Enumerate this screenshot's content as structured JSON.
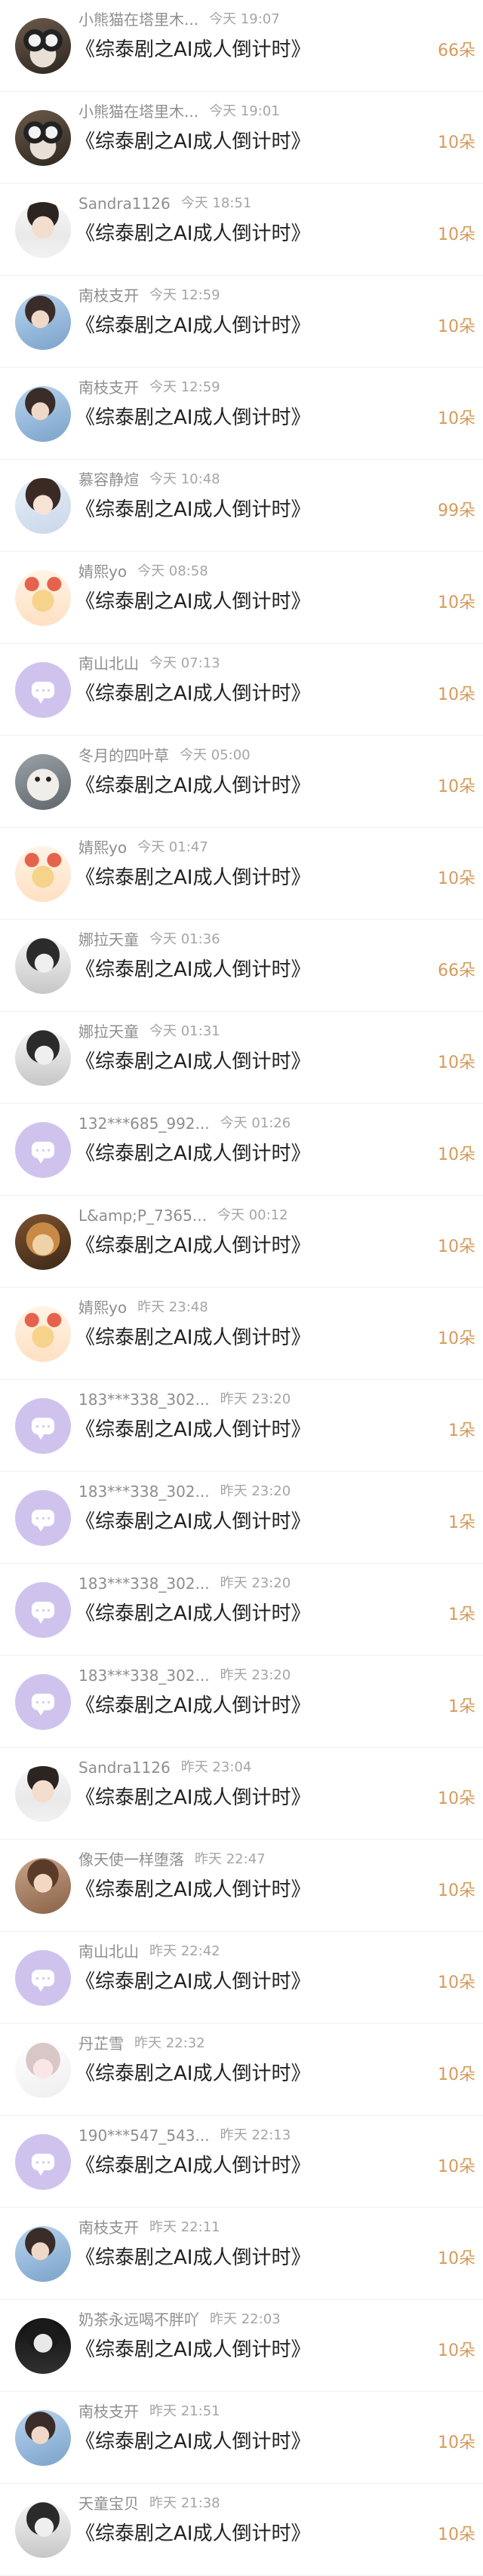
{
  "colors": {
    "accent": "#d69a5b",
    "name": "#8e8e8e",
    "time": "#a5a5a5",
    "title": "#222222",
    "placeholder_avatar": "#cfc3ee"
  },
  "rows": [
    {
      "name": "小熊猫在塔里木...",
      "time": "今天 19:07",
      "title": "《综泰剧之AI成人倒计时》",
      "amount": "66朵",
      "avatar": "photo-panda"
    },
    {
      "name": "小熊猫在塔里木...",
      "time": "今天 19:01",
      "title": "《综泰剧之AI成人倒计时》",
      "amount": "10朵",
      "avatar": "photo-panda"
    },
    {
      "name": "Sandra1126",
      "time": "今天 18:51",
      "title": "《综泰剧之AI成人倒计时》",
      "amount": "10朵",
      "avatar": "photo-boy"
    },
    {
      "name": "南枝支开",
      "time": "今天 12:59",
      "title": "《综泰剧之AI成人倒计时》",
      "amount": "10朵",
      "avatar": "photo-sky"
    },
    {
      "name": "南枝支开",
      "time": "今天 12:59",
      "title": "《综泰剧之AI成人倒计时》",
      "amount": "10朵",
      "avatar": "photo-sky"
    },
    {
      "name": "慕容静煊",
      "time": "今天 10:48",
      "title": "《综泰剧之AI成人倒计时》",
      "amount": "99朵",
      "avatar": "photo-girl"
    },
    {
      "name": "婧熙yo",
      "time": "今天 08:58",
      "title": "《综泰剧之AI成人倒计时》",
      "amount": "10朵",
      "avatar": "photo-cute"
    },
    {
      "name": "南山北山",
      "time": "今天 07:13",
      "title": "《综泰剧之AI成人倒计时》",
      "amount": "10朵",
      "avatar": "placeholder"
    },
    {
      "name": "冬月的四叶草",
      "time": "今天 05:00",
      "title": "《综泰剧之AI成人倒计时》",
      "amount": "10朵",
      "avatar": "photo-cat"
    },
    {
      "name": "婧熙yo",
      "time": "今天 01:47",
      "title": "《综泰剧之AI成人倒计时》",
      "amount": "10朵",
      "avatar": "photo-cute"
    },
    {
      "name": "娜拉天童",
      "time": "今天 01:36",
      "title": "《综泰剧之AI成人倒计时》",
      "amount": "66朵",
      "avatar": "photo-bw"
    },
    {
      "name": "娜拉天童",
      "time": "今天 01:31",
      "title": "《综泰剧之AI成人倒计时》",
      "amount": "10朵",
      "avatar": "photo-bw"
    },
    {
      "name": "132***685_992...",
      "time": "今天 01:26",
      "title": "《综泰剧之AI成人倒计时》",
      "amount": "10朵",
      "avatar": "placeholder"
    },
    {
      "name": "L&amp;P_7365...",
      "time": "今天 00:12",
      "title": "《综泰剧之AI成人倒计时》",
      "amount": "10朵",
      "avatar": "photo-dog"
    },
    {
      "name": "婧熙yo",
      "time": "昨天 23:48",
      "title": "《综泰剧之AI成人倒计时》",
      "amount": "10朵",
      "avatar": "photo-cute"
    },
    {
      "name": "183***338_302...",
      "time": "昨天 23:20",
      "title": "《综泰剧之AI成人倒计时》",
      "amount": "1朵",
      "avatar": "placeholder"
    },
    {
      "name": "183***338_302...",
      "time": "昨天 23:20",
      "title": "《综泰剧之AI成人倒计时》",
      "amount": "1朵",
      "avatar": "placeholder"
    },
    {
      "name": "183***338_302...",
      "time": "昨天 23:20",
      "title": "《综泰剧之AI成人倒计时》",
      "amount": "1朵",
      "avatar": "placeholder"
    },
    {
      "name": "183***338_302...",
      "time": "昨天 23:20",
      "title": "《综泰剧之AI成人倒计时》",
      "amount": "1朵",
      "avatar": "placeholder"
    },
    {
      "name": "Sandra1126",
      "time": "昨天 23:04",
      "title": "《综泰剧之AI成人倒计时》",
      "amount": "10朵",
      "avatar": "photo-boy"
    },
    {
      "name": "像天使一样堕落",
      "time": "昨天 22:47",
      "title": "《综泰剧之AI成人倒计时》",
      "amount": "10朵",
      "avatar": "photo-warm"
    },
    {
      "name": "南山北山",
      "time": "昨天 22:42",
      "title": "《综泰剧之AI成人倒计时》",
      "amount": "10朵",
      "avatar": "placeholder"
    },
    {
      "name": "丹芷雪",
      "time": "昨天 22:32",
      "title": "《综泰剧之AI成人倒计时》",
      "amount": "10朵",
      "avatar": "photo-soft"
    },
    {
      "name": "190***547_543...",
      "time": "昨天 22:13",
      "title": "《综泰剧之AI成人倒计时》",
      "amount": "10朵",
      "avatar": "placeholder"
    },
    {
      "name": "南枝支开",
      "time": "昨天 22:11",
      "title": "《综泰剧之AI成人倒计时》",
      "amount": "10朵",
      "avatar": "photo-sky"
    },
    {
      "name": "奶茶永远喝不胖吖",
      "time": "昨天 22:03",
      "title": "《综泰剧之AI成人倒计时》",
      "amount": "10朵",
      "avatar": "photo-dark"
    },
    {
      "name": "南枝支开",
      "time": "昨天 21:51",
      "title": "《综泰剧之AI成人倒计时》",
      "amount": "10朵",
      "avatar": "photo-sky"
    },
    {
      "name": "天童宝贝",
      "time": "昨天 21:38",
      "title": "《综泰剧之AI成人倒计时》",
      "amount": "10朵",
      "avatar": "photo-bw"
    }
  ]
}
